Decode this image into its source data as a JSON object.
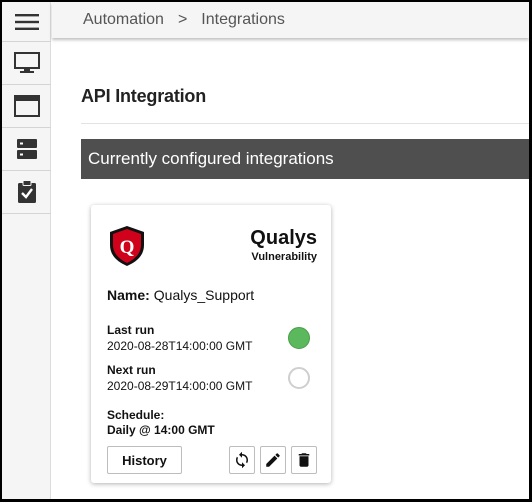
{
  "breadcrumb": {
    "items": [
      "Automation",
      "Integrations"
    ],
    "separator": ">"
  },
  "sidebar": {
    "items": [
      {
        "icon": "hamburger-icon"
      },
      {
        "icon": "monitor-icon"
      },
      {
        "icon": "browser-window-icon"
      },
      {
        "icon": "server-icon"
      },
      {
        "icon": "clipboard-check-icon"
      }
    ]
  },
  "main": {
    "title": "API Integration",
    "section_header": "Currently configured integrations"
  },
  "card": {
    "vendor": "Qualys",
    "type": "Vulnerability",
    "name_label": "Name:",
    "name_value": "Qualys_Support",
    "last_run_label": "Last run",
    "last_run_value": "2020-08-28T14:00:00 GMT",
    "next_run_label": "Next run",
    "next_run_value": "2020-08-29T14:00:00 GMT",
    "schedule_label": "Schedule:",
    "schedule_value": "Daily @ 14:00 GMT",
    "history_label": "History",
    "logo_letter": "Q"
  },
  "colors": {
    "section_header_bg": "#4f4f4f",
    "status_active": "#5cb85c",
    "logo_red": "#d0021b"
  }
}
